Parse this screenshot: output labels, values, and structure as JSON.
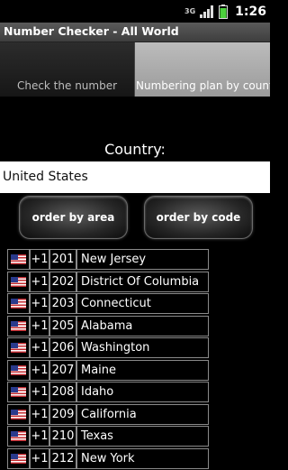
{
  "status_bar": {
    "network": "3G",
    "time": "1:26",
    "icons": [
      "3g-icon",
      "signal-icon",
      "battery-icon"
    ]
  },
  "app": {
    "title": "Number Checker - All World"
  },
  "tabs": [
    {
      "label": "Check the number",
      "selected": false
    },
    {
      "label": "Numbering plan by country",
      "selected": true
    }
  ],
  "country": {
    "label": "Country:",
    "value": "United States"
  },
  "buttons": {
    "order_by_area": "order by area",
    "order_by_code": "order by code"
  },
  "rows": [
    {
      "flag": "us-flag-icon",
      "prefix": "+1",
      "code": "201",
      "name": "New Jersey"
    },
    {
      "flag": "us-flag-icon",
      "prefix": "+1",
      "code": "202",
      "name": "District Of Columbia"
    },
    {
      "flag": "us-flag-icon",
      "prefix": "+1",
      "code": "203",
      "name": "Connecticut"
    },
    {
      "flag": "us-flag-icon",
      "prefix": "+1",
      "code": "205",
      "name": "Alabama"
    },
    {
      "flag": "us-flag-icon",
      "prefix": "+1",
      "code": "206",
      "name": "Washington"
    },
    {
      "flag": "us-flag-icon",
      "prefix": "+1",
      "code": "207",
      "name": "Maine"
    },
    {
      "flag": "us-flag-icon",
      "prefix": "+1",
      "code": "208",
      "name": "Idaho"
    },
    {
      "flag": "us-flag-icon",
      "prefix": "+1",
      "code": "209",
      "name": "California"
    },
    {
      "flag": "us-flag-icon",
      "prefix": "+1",
      "code": "210",
      "name": "Texas"
    },
    {
      "flag": "us-flag-icon",
      "prefix": "+1",
      "code": "212",
      "name": "New York"
    }
  ],
  "colors": {
    "background": "#000000",
    "selected_tab": "#a9a9a9",
    "battery": "#4cd23c"
  }
}
